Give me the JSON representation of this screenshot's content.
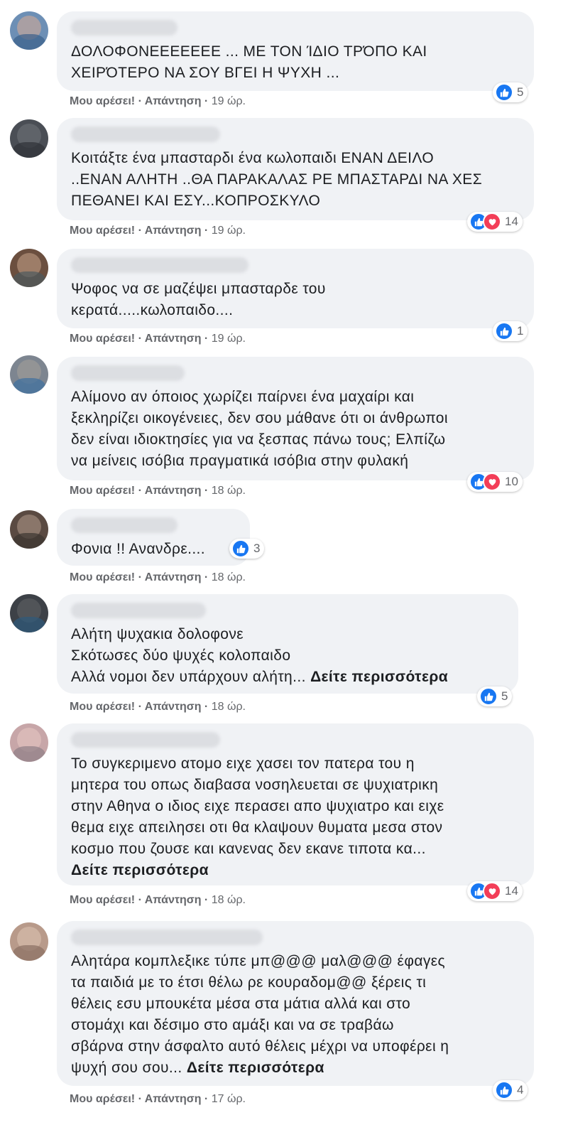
{
  "actions": {
    "like": "Μου αρέσει!",
    "reply": "Απάντηση",
    "sep": " · "
  },
  "colors": {
    "like": "#1877f2",
    "love": "#f33e58",
    "bubble": "#f0f2f5"
  },
  "comments": [
    {
      "text": "ΔΟΛΟΦΟΝΕΕΕΕΕΕΕ ... ΜΕ ΤΟΝ ΊΔΙΟ ΤΡΌΠΟ ΚΑΙ\nΧΕΙΡΌΤΕΡΟ ΝΑ ΣΟΥ ΒΓΕΙ Η ΨΥΧΗ ...",
      "see_more": "",
      "time": "19 ώρ.",
      "reactions": [
        "like"
      ],
      "count": "5"
    },
    {
      "text": "Κοιτάξτε ένα μπασταρδι ένα κωλοπαιδι ΕΝΑΝ ΔΕΙΛΟ\n..ΕΝΑΝ ΑΛΗΤΗ ..ΘΑ ΠΑΡΑΚΑΛΑΣ ΡΕ ΜΠΑΣΤΑΡΔΙ ΝΑ ΧΕΣ\nΠΕΘΑΝΕΙ ΚΑΙ ΕΣΥ...ΚΟΠΡΟΣΚΥΛΟ",
      "see_more": "",
      "time": "19 ώρ.",
      "reactions": [
        "like",
        "love"
      ],
      "count": "14"
    },
    {
      "text": "Ψοφος να σε μαζέψει μπασταρδε του\nκερατά.....κωλοπαιδο....",
      "see_more": "",
      "time": "19 ώρ.",
      "reactions": [
        "like"
      ],
      "count": "1"
    },
    {
      "text": "Αλίμονο αν όποιος χωρίζει παίρνει ένα μαχαίρι και\nξεκληρίζει οικογένειες, δεν σου μάθανε ότι οι άνθρωποι\nδεν είναι ιδιοκτησίες για να ξεσπας πάνω τους; Ελπίζω\nνα μείνεις ισόβια πραγματικά ισόβια στην φυλακή",
      "see_more": "",
      "time": "18 ώρ.",
      "reactions": [
        "like",
        "love"
      ],
      "count": "10"
    },
    {
      "text": "Φονια !! Ανανδρε....",
      "see_more": "",
      "time": "18 ώρ.",
      "reactions": [
        "like"
      ],
      "count": "3"
    },
    {
      "text": "Αλήτη ψυχακια δολοφονε\nΣκότωσες δύο ψυχές κολοπαιδο\nΑλλά νομοι δεν υπάρχουν αλήτη... ",
      "see_more": "Δείτε περισσότερα",
      "time": "18 ώρ.",
      "reactions": [
        "like"
      ],
      "count": "5"
    },
    {
      "text": "Το συγκεριμενο ατομο ειχε χασει τον πατερα του η\nμητερα του οπως διαβασα νοσηλευεται σε ψυχιατρικη\nστην Αθηνα ο ιδιος ειχε περασει απο ψυχιατρο και ειχε\nθεμα ειχε απειλησει οτι θα κλαψουν θυματα μεσα στον\nκοσμο που ζουσε και κανενας δεν εκανε τιποτα κα...\n",
      "see_more": "Δείτε περισσότερα",
      "time": "18 ώρ.",
      "reactions": [
        "like",
        "love"
      ],
      "count": "14"
    },
    {
      "text": "Αλητάρα κομπλεξικε τύπε μπ@@@ μαλ@@@ έφαγες\nτα παιδιά με το έτσι θέλω ρε κουραδομ@@ ξέρεις τι\nθέλεις εσυ μπουκέτα μέσα στα μάτια αλλά και στο\nστομάχι και δέσιμο στο αμάξι και να σε τραβάω\nσβάρνα στην άσφαλτο αυτό θέλεις μέχρι να υποφέρει η\nψυχή σου σου... ",
      "see_more": "Δείτε περισσότερα",
      "time": "17 ώρ.",
      "reactions": [
        "like"
      ],
      "count": "4"
    }
  ]
}
